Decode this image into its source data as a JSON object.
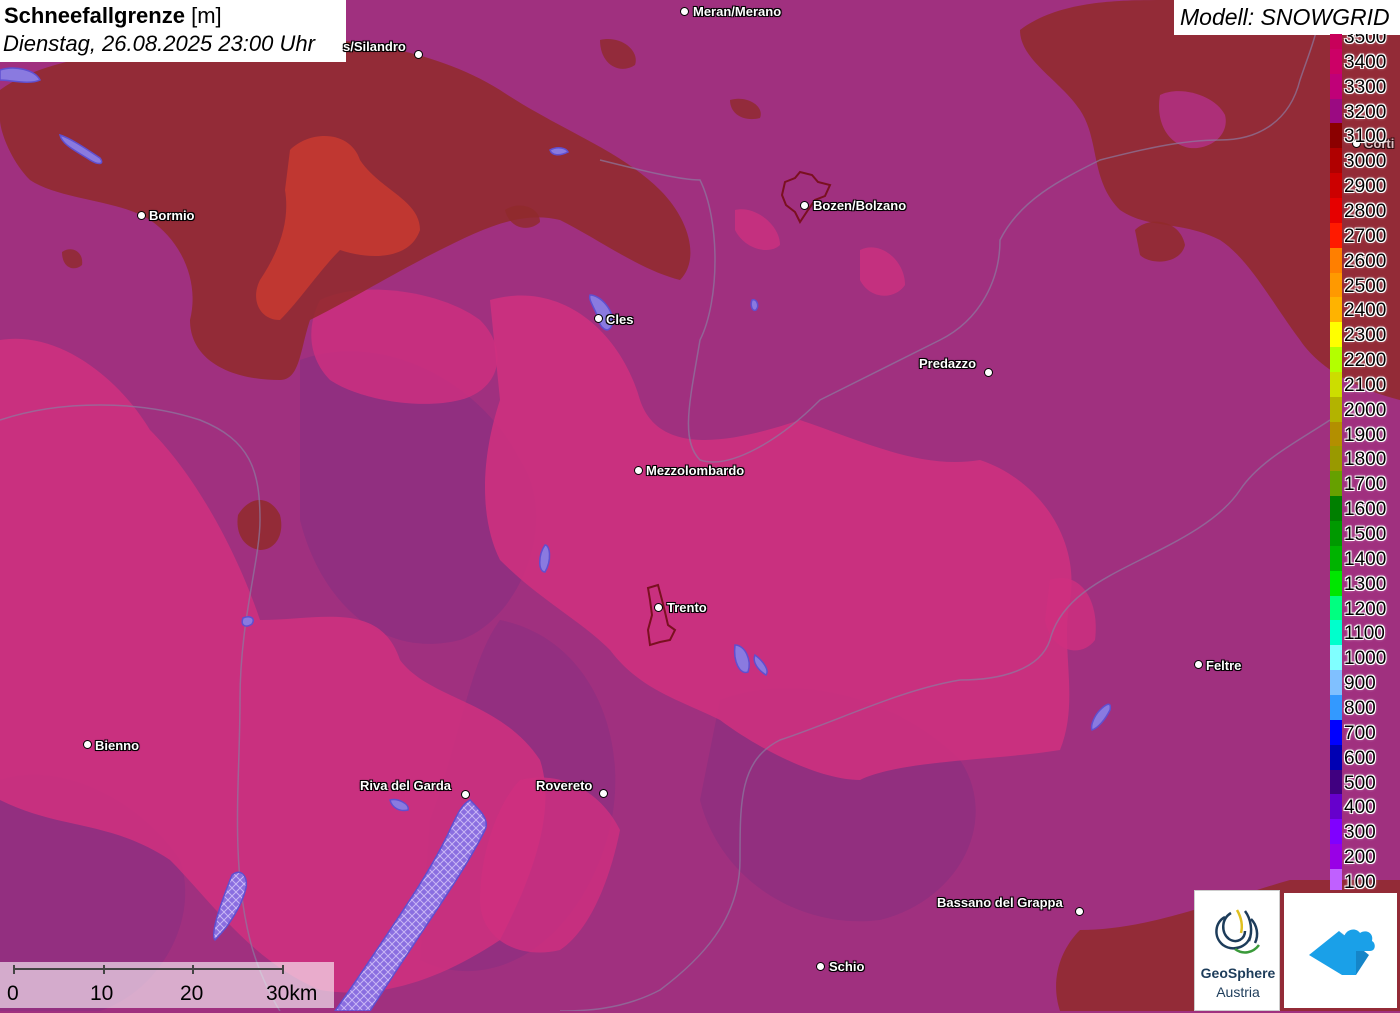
{
  "header": {
    "title_bold": "Schneefallgrenze",
    "title_unit": "[m]",
    "datetime": "Dienstag, 26.08.2025 23:00 Uhr"
  },
  "model_label": "Modell: SNOWGRID",
  "cities": [
    {
      "name": "Meran/Merano"
    },
    {
      "name": "s/Silandro"
    },
    {
      "name": "Bormio"
    },
    {
      "name": "Bozen/Bolzano"
    },
    {
      "name": "Cles"
    },
    {
      "name": "Predazzo"
    },
    {
      "name": "Mezzolombardo"
    },
    {
      "name": "Trento"
    },
    {
      "name": "Feltre"
    },
    {
      "name": "Bienno"
    },
    {
      "name": "Riva del Garda"
    },
    {
      "name": "Rovereto"
    },
    {
      "name": "Bassano del Grappa"
    },
    {
      "name": "Schio"
    },
    {
      "name": "Corti"
    }
  ],
  "legend": {
    "items": [
      {
        "label": "3500",
        "color": "#c8005a"
      },
      {
        "label": "3400",
        "color": "#cc0066"
      },
      {
        "label": "3300",
        "color": "#c00078"
      },
      {
        "label": "3200",
        "color": "#9b0a82"
      },
      {
        "label": "3100",
        "color": "#8b0000"
      },
      {
        "label": "3000",
        "color": "#b00000"
      },
      {
        "label": "2900",
        "color": "#cc0000"
      },
      {
        "label": "2800",
        "color": "#e60000"
      },
      {
        "label": "2700",
        "color": "#ff1a00"
      },
      {
        "label": "2600",
        "color": "#ff7f00"
      },
      {
        "label": "2500",
        "color": "#ff9900"
      },
      {
        "label": "2400",
        "color": "#ffb300"
      },
      {
        "label": "2300",
        "color": "#ffff00"
      },
      {
        "label": "2200",
        "color": "#b3ff00"
      },
      {
        "label": "2100",
        "color": "#ccdd00"
      },
      {
        "label": "2000",
        "color": "#b3b300"
      },
      {
        "label": "1900",
        "color": "#b38f00"
      },
      {
        "label": "1800",
        "color": "#999900"
      },
      {
        "label": "1700",
        "color": "#66a000"
      },
      {
        "label": "1600",
        "color": "#007f00"
      },
      {
        "label": "1500",
        "color": "#009900"
      },
      {
        "label": "1400",
        "color": "#00b300"
      },
      {
        "label": "1300",
        "color": "#00e600"
      },
      {
        "label": "1200",
        "color": "#00ff80"
      },
      {
        "label": "1100",
        "color": "#00ffcc"
      },
      {
        "label": "1000",
        "color": "#80ffff"
      },
      {
        "label": "900",
        "color": "#80c0ff"
      },
      {
        "label": "800",
        "color": "#3399ff"
      },
      {
        "label": "700",
        "color": "#0000ff"
      },
      {
        "label": "600",
        "color": "#0000b3"
      },
      {
        "label": "500",
        "color": "#400080"
      },
      {
        "label": "400",
        "color": "#6600cc"
      },
      {
        "label": "300",
        "color": "#8000ff"
      },
      {
        "label": "200",
        "color": "#9900e6"
      },
      {
        "label": "100",
        "color": "#c060ff"
      }
    ]
  },
  "scale": {
    "ticks": [
      "0",
      "10",
      "20",
      "30km"
    ]
  },
  "logos": {
    "geosphere_line1": "GeoSphere",
    "geosphere_line2": "Austria"
  },
  "map_colors": {
    "base": "#a0307f",
    "pink": "#d0307f",
    "dark_purple": "#8a2f80",
    "brown": "#902a2a",
    "red": "#c83a30",
    "lake": "#6e6ef0"
  }
}
